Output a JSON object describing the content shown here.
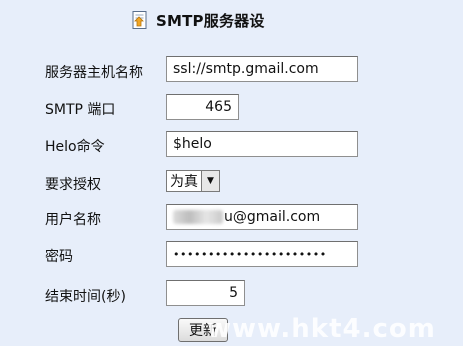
{
  "title": "SMTP服务器设",
  "form": {
    "host": {
      "label": "服务器主机名称",
      "value": "ssl://smtp.gmail.com"
    },
    "port": {
      "label": "SMTP 端口",
      "value": "465"
    },
    "helo": {
      "label": "Helo命令",
      "value": "$helo"
    },
    "auth": {
      "label": "要求授权",
      "value": "为真"
    },
    "username": {
      "label": "用户名称",
      "value_suffix": "u@gmail.com"
    },
    "password": {
      "label": "密码",
      "value": "••••••••••••••••••••••"
    },
    "timeout": {
      "label": "结束时间(秒)",
      "value": "5"
    }
  },
  "submit_label": "更新",
  "watermark": "www.hkt4.com"
}
